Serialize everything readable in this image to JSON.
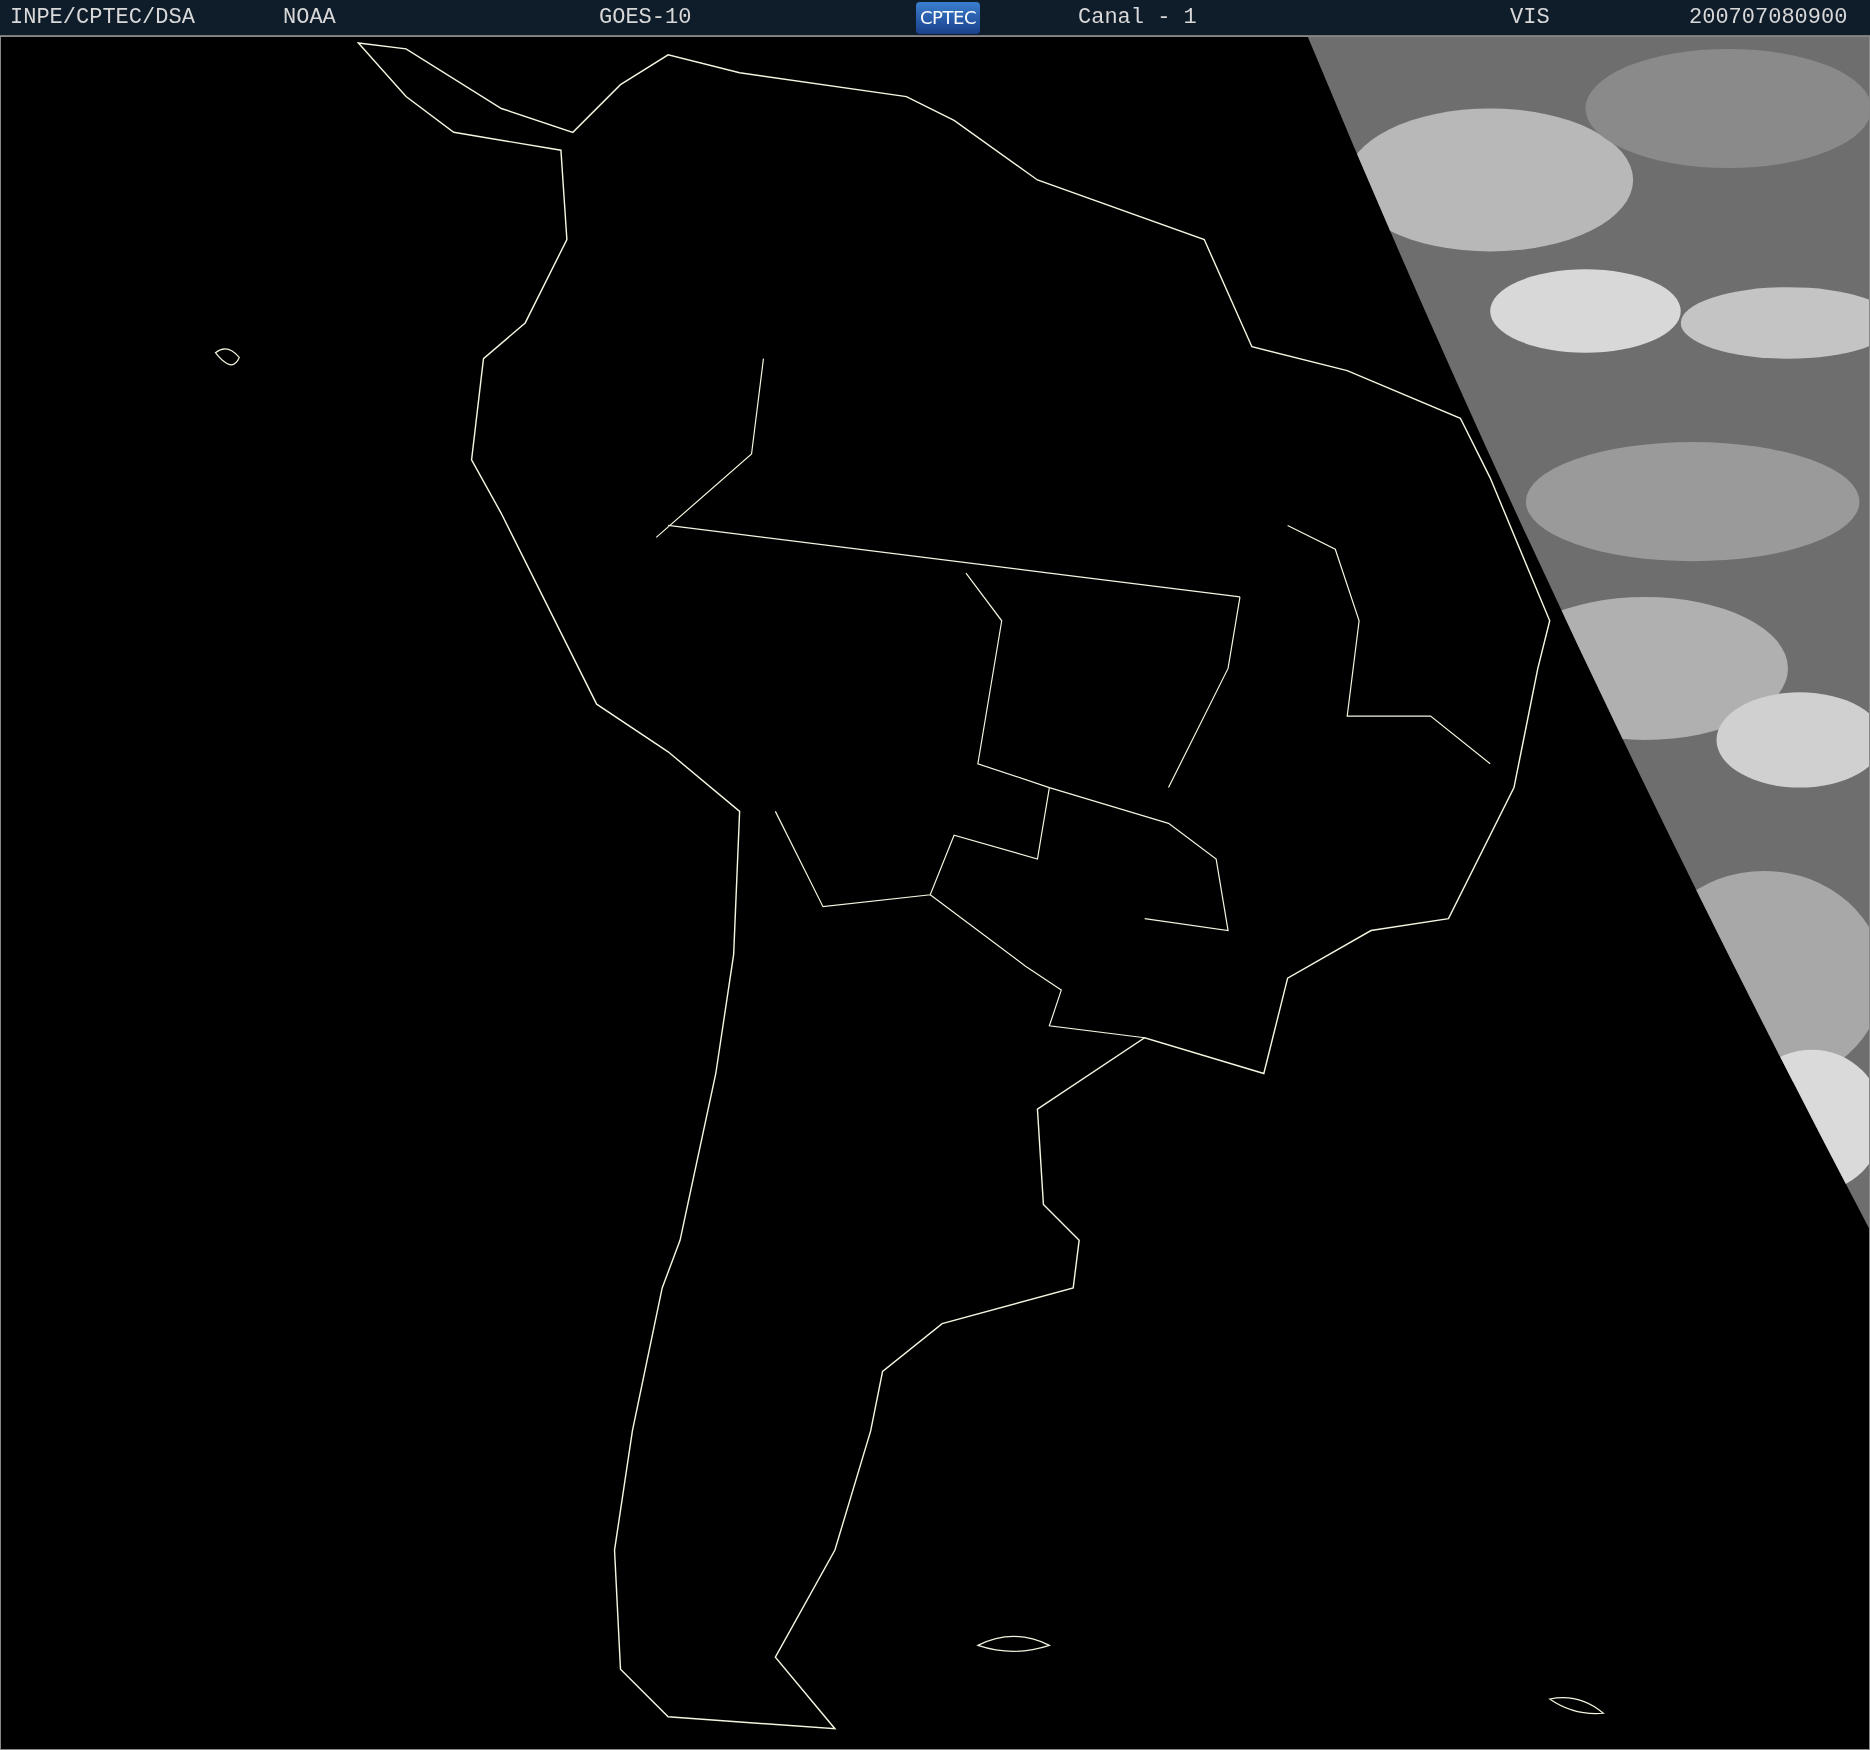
{
  "header": {
    "items": [
      {
        "kind": "text",
        "text": "INPE/CPTEC/DSA"
      },
      {
        "kind": "text",
        "text": "NOAA"
      },
      {
        "kind": "text",
        "text": "GOES-10"
      },
      {
        "kind": "logo",
        "text": "CPTEC"
      },
      {
        "kind": "text",
        "text": "Canal - 1"
      },
      {
        "kind": "text",
        "text": "VIS"
      },
      {
        "kind": "text",
        "text": "200707080900"
      }
    ]
  }
}
